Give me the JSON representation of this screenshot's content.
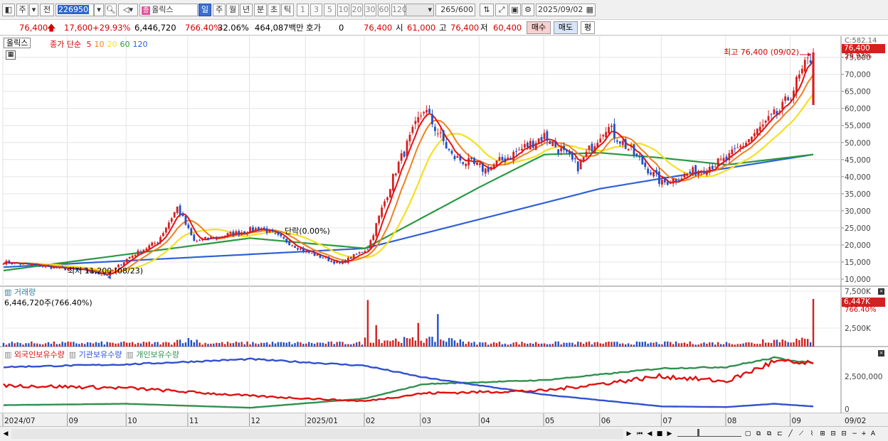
{
  "toolbar": {
    "market": "주",
    "prev_label": "전",
    "code": "226950",
    "name": "올릭스",
    "name_chip": "증",
    "periods": [
      "일",
      "주",
      "월",
      "년",
      "분",
      "초",
      "틱"
    ],
    "active_period": "일",
    "intervals": [
      "1",
      "3",
      "5",
      "10",
      "20",
      "30",
      "60",
      "120"
    ],
    "count": "265",
    "count_total": "/600",
    "date": "2025/09/02"
  },
  "quote": {
    "price": "76,400",
    "change": "17,600",
    "change_pct": "+29.93%",
    "volume": "6,446,720",
    "volume_ratio": "766.40%",
    "turnover": "32.06%",
    "amount": "464,087백만",
    "hoga_label": "호가",
    "hoga_value": "0",
    "hoga_price": "76,400",
    "open_label": "시",
    "open": "61,000",
    "high_label": "고",
    "high": "76,400",
    "low_label": "저",
    "low": "60,400",
    "buy_label": "매수",
    "sell_label": "매도",
    "eval_label": "평"
  },
  "price_pane": {
    "name_box": "올릭스",
    "legend_title": "종가 단순",
    "ma_labels": [
      "5",
      "10",
      "20",
      "60",
      "120"
    ],
    "ma_colors": [
      "#e81010",
      "#f08020",
      "#f5e020",
      "#2a9a40",
      "#3060d8"
    ],
    "y_ticks": [
      "75,000",
      "70,000",
      "65,000",
      "60,000",
      "55,000",
      "50,000",
      "45,000",
      "40,000",
      "35,000",
      "30,000",
      "25,000",
      "20,000",
      "15,000",
      "10,000"
    ],
    "top_label": "C:582.14",
    "current_price_tag": "76,400",
    "current_pct_tag": "29.93%",
    "high_annotation": "최고 76,400 (09/02)",
    "low_annotation": "최저 11,200 (08/23)",
    "event_annotation": "단락(0.00%)"
  },
  "volume_pane": {
    "title": "거래량",
    "value_text": "6,446,720주(766.40%)",
    "y_ticks": [
      "7,500K",
      "2,500K"
    ],
    "tag_value": "6,447K",
    "tag_pct": "766.40%"
  },
  "holding_pane": {
    "legend": [
      "외국인보유수량",
      "기관보유수량",
      "개인보유수량"
    ],
    "legend_colors": [
      "#e01010",
      "#3050d0",
      "#309050"
    ],
    "y_ticks": [
      "2,500,000",
      "0"
    ]
  },
  "x_axis": {
    "labels": [
      "2024/07",
      "09",
      "10",
      "11",
      "12",
      "2025/01",
      "02",
      "03",
      "04",
      "05",
      "06",
      "07",
      "08",
      "09"
    ],
    "right_label": "09/02"
  },
  "colors": {
    "up": "#d42020",
    "down": "#2050c8",
    "accent": "#2f66c9"
  },
  "chart_data": {
    "type": "candlestick",
    "ylim": [
      10000,
      77000
    ],
    "series_close_knots": [
      {
        "x": "2024/07",
        "y": 15000
      },
      {
        "x": "2024/08 (mid)",
        "y": 12500
      },
      {
        "x": "2024/08/23",
        "y": 11200
      },
      {
        "x": "2024/09",
        "y": 16500
      },
      {
        "x": "2024/10",
        "y": 21000
      },
      {
        "x": "2024/10 (mid)",
        "y": 31000
      },
      {
        "x": "2024/11",
        "y": 21000
      },
      {
        "x": "2024/12",
        "y": 25000
      },
      {
        "x": "2025/01",
        "y": 18000
      },
      {
        "x": "2025/01 (late)",
        "y": 14500
      },
      {
        "x": "2025/02",
        "y": 19000
      },
      {
        "x": "2025/02 (mid)",
        "y": 42000
      },
      {
        "x": "2025/03",
        "y": 60000
      },
      {
        "x": "2025/03 (mid)",
        "y": 46000
      },
      {
        "x": "2025/04",
        "y": 42000
      },
      {
        "x": "2025/05",
        "y": 52000
      },
      {
        "x": "2025/05 (late)",
        "y": 43000
      },
      {
        "x": "2025/06",
        "y": 55000
      },
      {
        "x": "2025/07",
        "y": 38000
      },
      {
        "x": "2025/08",
        "y": 45000
      },
      {
        "x": "2025/08 (late)",
        "y": 60000
      },
      {
        "x": "2025/09/02",
        "y": 76400
      }
    ],
    "ma120_knots": [
      {
        "x": "2024/07",
        "y": 13500
      },
      {
        "x": "2025/02",
        "y": 19000
      },
      {
        "x": "2025/06",
        "y": 36500
      },
      {
        "x": "2025/07",
        "y": 39500
      },
      {
        "x": "2025/09/02",
        "y": 46500
      }
    ],
    "ma60_knots": [
      {
        "x": "2024/07",
        "y": 12500
      },
      {
        "x": "2024/12",
        "y": 22000
      },
      {
        "x": "2025/02",
        "y": 19000
      },
      {
        "x": "2025/04",
        "y": 37000
      },
      {
        "x": "2025/05",
        "y": 46500
      },
      {
        "x": "2025/06",
        "y": 47000
      },
      {
        "x": "2025/07",
        "y": 45500
      },
      {
        "x": "2025/08",
        "y": 43500
      },
      {
        "x": "2025/09/02",
        "y": 46500
      }
    ]
  }
}
